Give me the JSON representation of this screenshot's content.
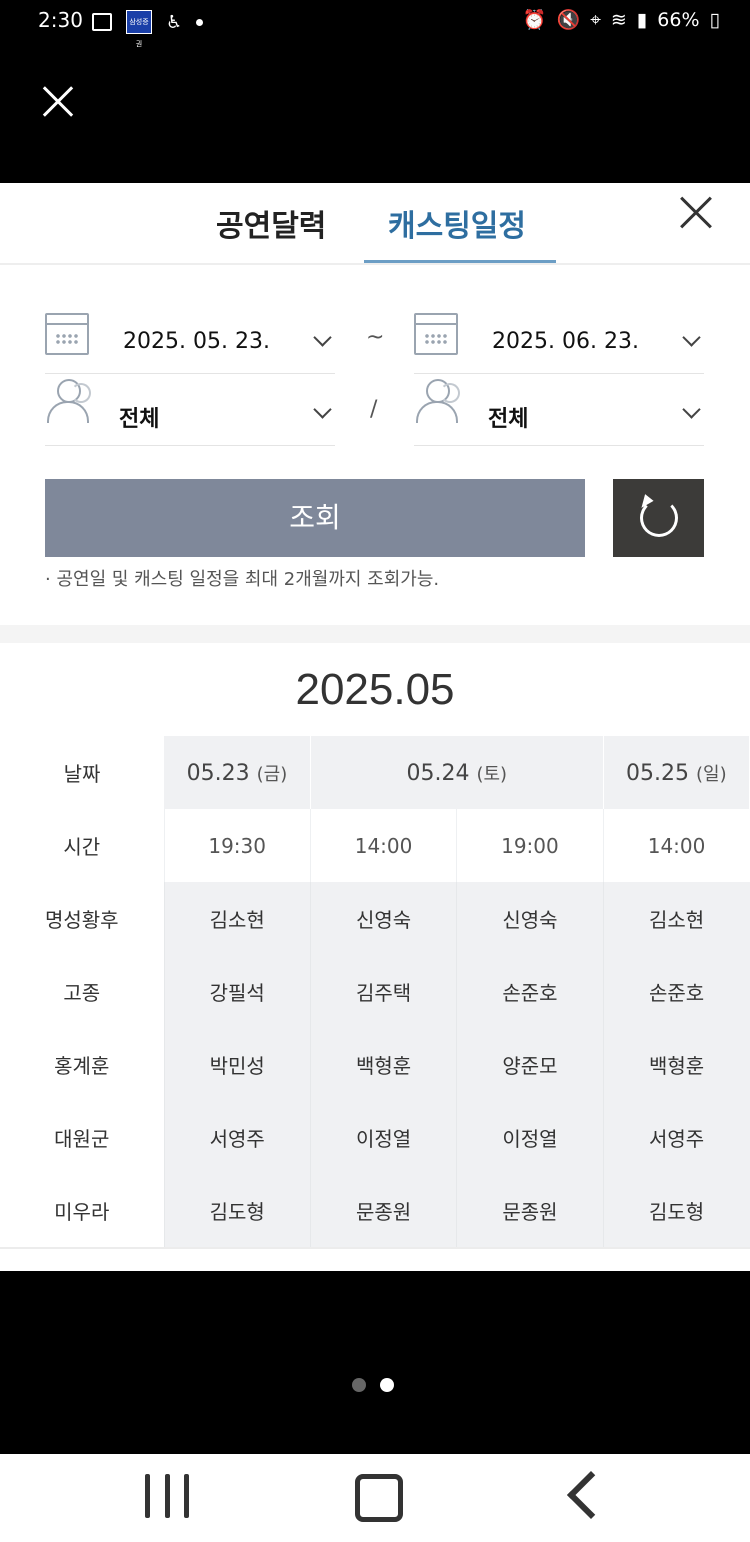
{
  "status_bar": {
    "time": "2:30",
    "battery": "66%",
    "notification_badge": "삼성증권"
  },
  "tabs": [
    {
      "label": "공연달력"
    },
    {
      "label": "캐스팅일정"
    }
  ],
  "filters": {
    "start_date": "2025. 05. 23.",
    "end_date": "2025. 06. 23.",
    "range_sep": "~",
    "cast_sep": "/",
    "cast_left": "전체",
    "cast_right": "전체"
  },
  "search_button": "조회",
  "note": "·  공연일 및 캐스팅 일정을 최대 2개월까지 조회가능.",
  "month": "2025.05",
  "schedule": {
    "date_label": "날짜",
    "time_label": "시간",
    "dates": [
      {
        "date": "05.23",
        "weekday": "(금)"
      },
      {
        "date": "05.24",
        "weekday": "(토)"
      },
      {
        "date": "05.25",
        "weekday": "(일)"
      }
    ],
    "times": [
      "19:30",
      "14:00",
      "19:00",
      "14:00"
    ],
    "roles": [
      {
        "role": "명성황후",
        "cast": [
          "김소현",
          "신영숙",
          "신영숙",
          "김소현"
        ]
      },
      {
        "role": "고종",
        "cast": [
          "강필석",
          "김주택",
          "손준호",
          "손준호"
        ]
      },
      {
        "role": "홍계훈",
        "cast": [
          "박민성",
          "백형훈",
          "양준모",
          "백형훈"
        ]
      },
      {
        "role": "대원군",
        "cast": [
          "서영주",
          "이정열",
          "이정열",
          "서영주"
        ]
      },
      {
        "role": "미우라",
        "cast": [
          "김도형",
          "문종원",
          "문종원",
          "김도형"
        ]
      }
    ]
  },
  "icons": {
    "close": "close-icon",
    "calendar": "calendar-icon",
    "person": "person-icon",
    "refresh": "refresh-icon"
  }
}
